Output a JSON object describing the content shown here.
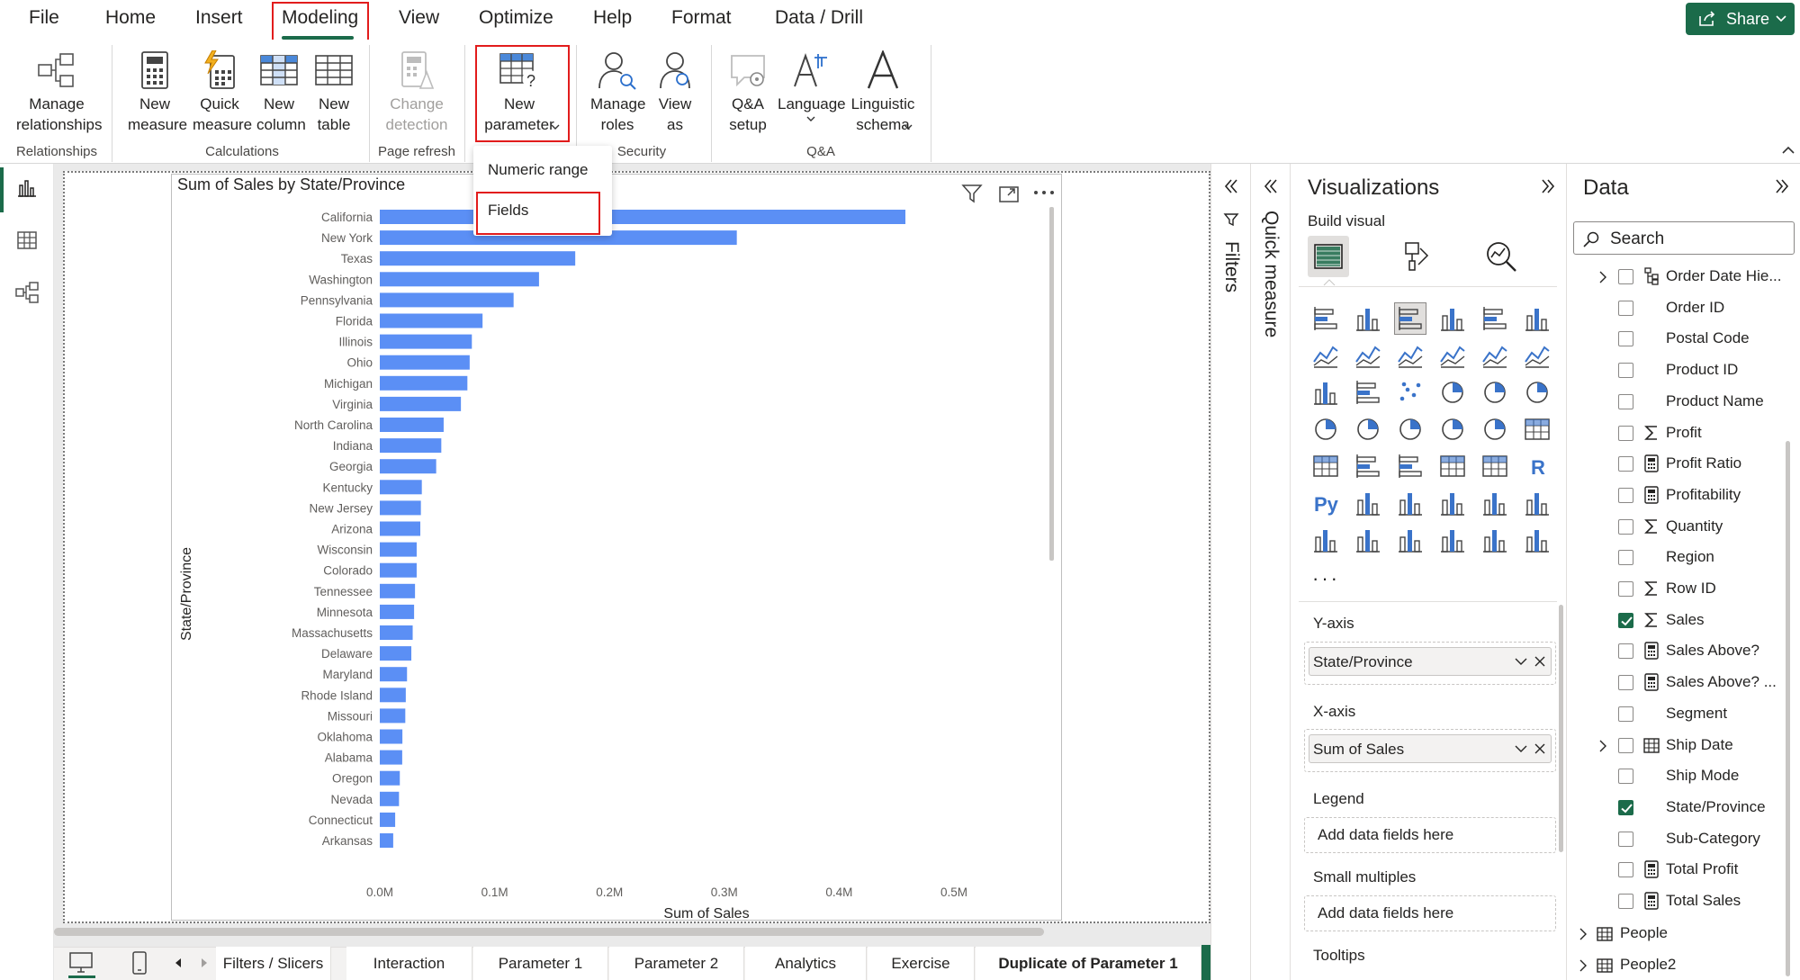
{
  "menu": {
    "tabs": [
      "File",
      "Home",
      "Insert",
      "Modeling",
      "View",
      "Optimize",
      "Help",
      "Format",
      "Data / Drill"
    ],
    "share_label": "Share"
  },
  "ribbon": {
    "manage_relationships": "Manage relationships",
    "new_measure": "New measure",
    "quick_measure": "Quick measure",
    "new_column": "New column",
    "new_table": "New table",
    "change_detection": "Change detection",
    "new_parameter": "New parameter",
    "manage_roles": "Manage roles",
    "view_as": "View as",
    "qa_setup": "Q&A setup",
    "language": "Language",
    "linguistic_schema": "Linguistic schema",
    "groups": {
      "relationships": "Relationships",
      "calculations": "Calculations",
      "page_refresh": "Page refresh",
      "security": "Security",
      "qa": "Q&A"
    }
  },
  "dropdown": {
    "items": [
      "Numeric range",
      "Fields"
    ]
  },
  "chart_data": {
    "type": "bar",
    "orientation": "horizontal",
    "title": "Sum of Sales by State/Province",
    "xlabel": "Sum of Sales",
    "ylabel": "State/Province",
    "categories": [
      "California",
      "New York",
      "Texas",
      "Washington",
      "Pennsylvania",
      "Florida",
      "Illinois",
      "Ohio",
      "Michigan",
      "Virginia",
      "North Carolina",
      "Indiana",
      "Georgia",
      "Kentucky",
      "New Jersey",
      "Arizona",
      "Wisconsin",
      "Colorado",
      "Tennessee",
      "Minnesota",
      "Massachusetts",
      "Delaware",
      "Maryland",
      "Rhode Island",
      "Missouri",
      "Oklahoma",
      "Alabama",
      "Oregon",
      "Nevada",
      "Connecticut",
      "Arkansas"
    ],
    "values": [
      457688,
      310876,
      170188,
      138641,
      116512,
      89474,
      80166,
      78258,
      76270,
      70637,
      55603,
      53555,
      49096,
      36592,
      35764,
      35282,
      32115,
      32108,
      30662,
      29863,
      28634,
      27451,
      23706,
      22628,
      22206,
      19683,
      19511,
      17431,
      16729,
      13384,
      11678
    ],
    "xticks": [
      "0.0M",
      "0.1M",
      "0.2M",
      "0.3M",
      "0.4M",
      "0.5M"
    ],
    "xlim": [
      0,
      500000
    ],
    "bar_color": "#5b8ff5",
    "grid": false
  },
  "pages": {
    "tabs": [
      "Filters / Slicers",
      "Interaction",
      "Parameter 1",
      "Parameter 2",
      "Analytics",
      "Exercise",
      "Duplicate of Parameter 1"
    ],
    "add_label": "+"
  },
  "filters": {
    "label": "Filters"
  },
  "quick_measure": {
    "label": "Quick measure"
  },
  "visualizations": {
    "title": "Visualizations",
    "build_visual": "Build visual",
    "wells": {
      "y_axis": "Y-axis",
      "y_field": "State/Province",
      "x_axis": "X-axis",
      "x_field": "Sum of Sales",
      "legend": "Legend",
      "legend_placeholder": "Add data fields here",
      "small_multiples": "Small multiples",
      "small_multiples_placeholder": "Add data fields here",
      "tooltips": "Tooltips"
    },
    "more": "···"
  },
  "data": {
    "title": "Data",
    "search_placeholder": "Search",
    "fields": [
      {
        "label": "Order Date Hie...",
        "icon": "hierarchy-icon",
        "checked": false,
        "expand": true
      },
      {
        "label": "Order ID",
        "icon": "",
        "checked": false,
        "expand": false
      },
      {
        "label": "Postal Code",
        "icon": "",
        "checked": false,
        "expand": false
      },
      {
        "label": "Product ID",
        "icon": "",
        "checked": false,
        "expand": false
      },
      {
        "label": "Product Name",
        "icon": "",
        "checked": false,
        "expand": false
      },
      {
        "label": "Profit",
        "icon": "sigma-icon",
        "checked": false,
        "expand": false
      },
      {
        "label": "Profit Ratio",
        "icon": "calculator-icon",
        "checked": false,
        "expand": false
      },
      {
        "label": "Profitability",
        "icon": "calculator-icon",
        "checked": false,
        "expand": false
      },
      {
        "label": "Quantity",
        "icon": "sigma-icon",
        "checked": false,
        "expand": false
      },
      {
        "label": "Region",
        "icon": "",
        "checked": false,
        "expand": false
      },
      {
        "label": "Row ID",
        "icon": "sigma-icon",
        "checked": false,
        "expand": false
      },
      {
        "label": "Sales",
        "icon": "sigma-icon",
        "checked": true,
        "expand": false
      },
      {
        "label": "Sales Above?",
        "icon": "calculator-icon",
        "checked": false,
        "expand": false
      },
      {
        "label": "Sales Above? ...",
        "icon": "calculator-icon",
        "checked": false,
        "expand": false
      },
      {
        "label": "Segment",
        "icon": "",
        "checked": false,
        "expand": false
      },
      {
        "label": "Ship Date",
        "icon": "calendar-icon",
        "checked": false,
        "expand": true
      },
      {
        "label": "Ship Mode",
        "icon": "",
        "checked": false,
        "expand": false
      },
      {
        "label": "State/Province",
        "icon": "",
        "checked": true,
        "expand": false
      },
      {
        "label": "Sub-Category",
        "icon": "",
        "checked": false,
        "expand": false
      },
      {
        "label": "Total Profit",
        "icon": "calculator-icon",
        "checked": false,
        "expand": false
      },
      {
        "label": "Total Sales",
        "icon": "calculator-icon",
        "checked": false,
        "expand": false
      }
    ],
    "tables": [
      "People",
      "People2"
    ]
  }
}
